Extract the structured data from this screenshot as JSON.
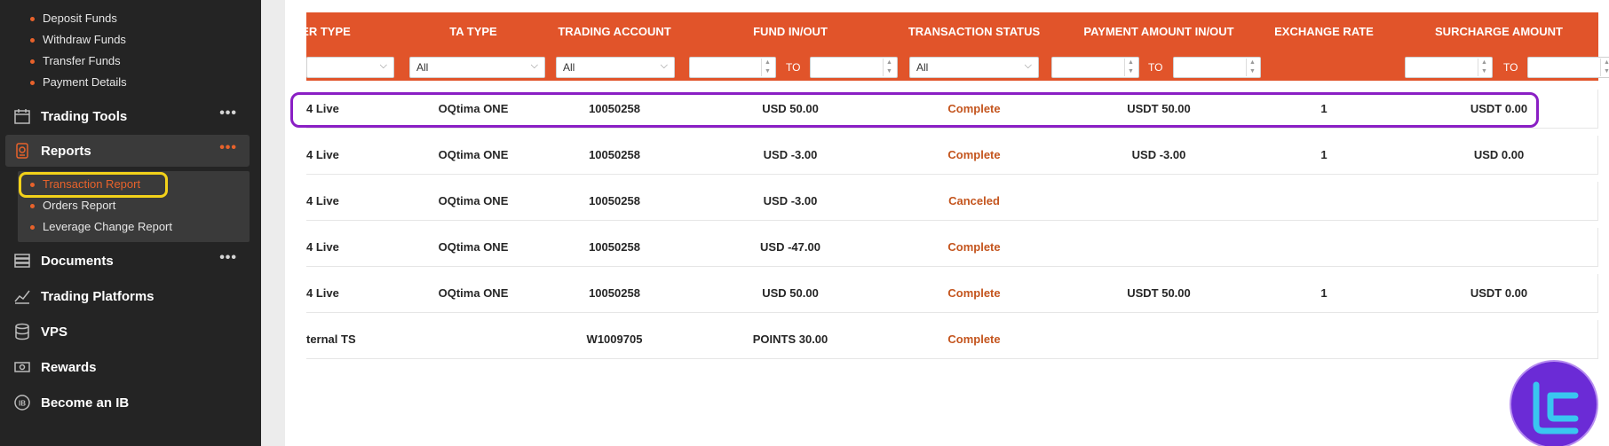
{
  "sidebar": {
    "funds_items": [
      "Deposit Funds",
      "Withdraw Funds",
      "Transfer Funds",
      "Payment Details"
    ],
    "trading_tools": "Trading Tools",
    "reports": "Reports",
    "reports_items": [
      "Transaction Report",
      "Orders Report",
      "Leverage Change Report"
    ],
    "documents": "Documents",
    "trading_platforms": "Trading Platforms",
    "vps": "VPS",
    "rewards": "Rewards",
    "become_ib": "Become an IB",
    "more": "•••",
    "accent_color": "#e8622b"
  },
  "table": {
    "header_color": "#e1542a",
    "columns": [
      "ER TYPE",
      "TA TYPE",
      "TRADING ACCOUNT",
      "FUND IN/OUT",
      "TRANSACTION STATUS",
      "PAYMENT AMOUNT IN/OUT",
      "EXCHANGE RATE",
      "SURCHARGE AMOUNT"
    ],
    "filters": {
      "ta_type": "All",
      "trading_account": "All",
      "transaction_status": "All",
      "to_label": "TO"
    },
    "rows": [
      {
        "type": "4 Live",
        "ta_type": "OQtima ONE",
        "account": "10050258",
        "fund": "USD 50.00",
        "status": "Complete",
        "payment": "USDT 50.00",
        "rate": "1",
        "surcharge": "USDT 0.00"
      },
      {
        "type": "4 Live",
        "ta_type": "OQtima ONE",
        "account": "10050258",
        "fund": "USD -3.00",
        "status": "Complete",
        "payment": "USD -3.00",
        "rate": "1",
        "surcharge": "USD 0.00"
      },
      {
        "type": "4 Live",
        "ta_type": "OQtima ONE",
        "account": "10050258",
        "fund": "USD -3.00",
        "status": "Canceled",
        "payment": "",
        "rate": "",
        "surcharge": ""
      },
      {
        "type": "4 Live",
        "ta_type": "OQtima ONE",
        "account": "10050258",
        "fund": "USD -47.00",
        "status": "Complete",
        "payment": "",
        "rate": "",
        "surcharge": ""
      },
      {
        "type": "4 Live",
        "ta_type": "OQtima ONE",
        "account": "10050258",
        "fund": "USD 50.00",
        "status": "Complete",
        "payment": "USDT 50.00",
        "rate": "1",
        "surcharge": "USDT 0.00"
      },
      {
        "type": "ternal TS",
        "ta_type": "",
        "account": "W1009705",
        "fund": "POINTS 30.00",
        "status": "Complete",
        "payment": "",
        "rate": "",
        "surcharge": ""
      }
    ]
  },
  "badge": {
    "icon": "tc-logo-icon",
    "color": "#6b2bd6"
  }
}
